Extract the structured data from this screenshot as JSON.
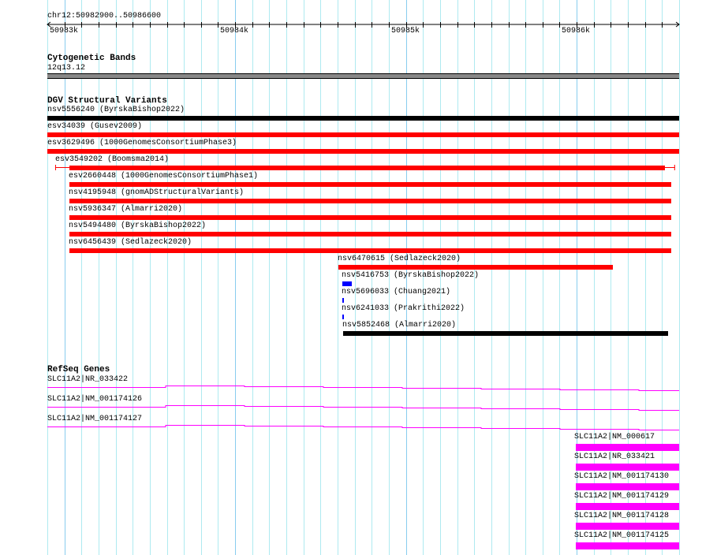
{
  "view": {
    "location": "chr12:50982900..50986600",
    "start": 50982900,
    "end": 50986600,
    "tick_labels": [
      "50983k",
      "50984k",
      "50985k",
      "50986k"
    ]
  },
  "colors": {
    "loss": "#ff0000",
    "complex": "#000000",
    "gain": "#0000ff",
    "gene": "#ff00ff",
    "band": "#888888"
  },
  "cytoband": {
    "title": "Cytogenetic Bands",
    "band": "12q13.12"
  },
  "dgv": {
    "title": "DGV Structural Variants",
    "features": [
      {
        "label": "nsv5556240 (ByrskaBishop2022)",
        "start": 50982900,
        "end": 50986600,
        "color": "#000000"
      },
      {
        "label": "esv34039 (Gusev2009)",
        "start": 50982900,
        "end": 50986600,
        "color": "#ff0000"
      },
      {
        "label": "esv3629496 (1000GenomesConsortiumPhase3)",
        "start": 50982900,
        "end": 50986600,
        "color": "#ff0000"
      },
      {
        "label": "esv3549202 (Boomsma2014)",
        "start": 50983030,
        "end": 50986516,
        "outer_start": 50982946,
        "outer_end": 50986576,
        "color": "#ff0000"
      },
      {
        "label": "esv2660448 (1000GenomesConsortiumPhase1)",
        "start": 50983030,
        "end": 50986553,
        "color": "#ff0000"
      },
      {
        "label": "nsv4195948 (gnomADStructuralVariants)",
        "start": 50983030,
        "end": 50986553,
        "color": "#ff0000"
      },
      {
        "label": "nsv5936347 (Almarri2020)",
        "start": 50983030,
        "end": 50986553,
        "color": "#ff0000"
      },
      {
        "label": "nsv5494480 (ByrskaBishop2022)",
        "start": 50983030,
        "end": 50986553,
        "color": "#ff0000"
      },
      {
        "label": "nsv6456439 (Sedlazeck2020)",
        "start": 50983030,
        "end": 50986553,
        "color": "#ff0000"
      },
      {
        "label": "nsv6470615 (Sedlazeck2020)",
        "start": 50984604,
        "end": 50986210,
        "color": "#ff0000"
      },
      {
        "label": "nsv5416753 (ByrskaBishop2022)",
        "start": 50984627,
        "end": 50984683,
        "color": "#0000ff"
      },
      {
        "label": "nsv5696033 (Chuang2021)",
        "start": 50984627,
        "end": 50984636,
        "color": "#0000ff"
      },
      {
        "label": "nsv6241033 (Prakrithi2022)",
        "start": 50984627,
        "end": 50984636,
        "color": "#0000ff"
      },
      {
        "label": "nsv5852468 (Almarri2020)",
        "start": 50984632,
        "end": 50986534,
        "color": "#000000"
      }
    ]
  },
  "refseq": {
    "title": "RefSeq Genes",
    "long_genes": [
      {
        "label": "SLC11A2|NR_033422"
      },
      {
        "label": "SLC11A2|NM_001174126"
      },
      {
        "label": "SLC11A2|NM_001174127"
      }
    ],
    "short_genes": [
      {
        "label": "SLC11A2|NM_000617",
        "start": 50985993,
        "end": 50986600
      },
      {
        "label": "SLC11A2|NR_033421",
        "start": 50985993,
        "end": 50986600
      },
      {
        "label": "SLC11A2|NM_001174130",
        "start": 50985993,
        "end": 50986600
      },
      {
        "label": "SLC11A2|NM_001174129",
        "start": 50985993,
        "end": 50986600
      },
      {
        "label": "SLC11A2|NM_001174128",
        "start": 50985993,
        "end": 50986600
      },
      {
        "label": "SLC11A2|NM_001174125",
        "start": 50985993,
        "end": 50986600
      }
    ]
  }
}
